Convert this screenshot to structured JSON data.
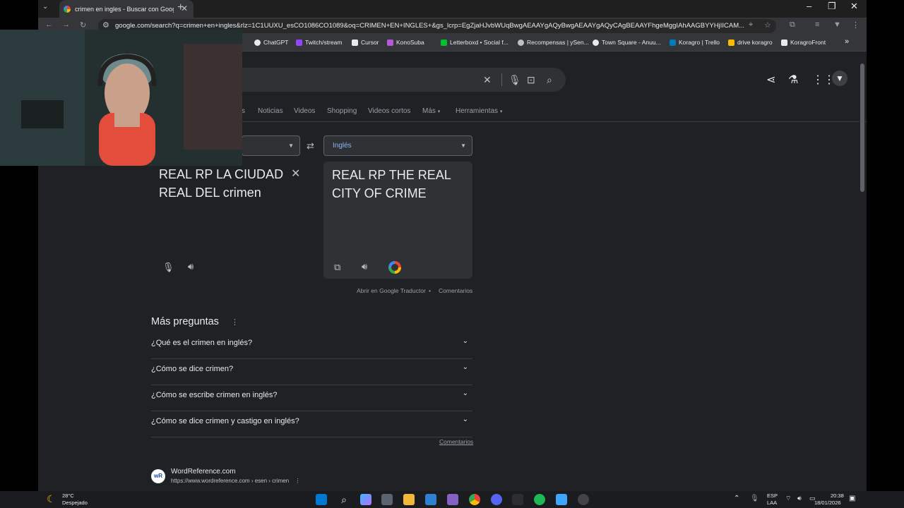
{
  "tab": {
    "title": "crimen en ingles - Buscar con Google"
  },
  "address_bar": {
    "url": "google.com/search?q=crimen+en+ingles&rlz=1C1UUXU_esCO1086CO1089&oq=CRIMEN+EN+INGLES+&gs_lcrp=EgZjaHJvbWUqBwgAEAAYgAQyBwgAEAAYgAQyCAgBEAAYFhgeMggIAhAAGBYYHjIICAM..."
  },
  "bookmarks": [
    {
      "label": "ChatGPT"
    },
    {
      "label": "Twitch/stream"
    },
    {
      "label": "Cursor"
    },
    {
      "label": "KonoSuba"
    },
    {
      "label": "Letterboxd • Social f..."
    },
    {
      "label": "Recompensas | ySen..."
    },
    {
      "label": "Town Square - Anuu..."
    },
    {
      "label": "Koragro | Trello"
    },
    {
      "label": "drive koragro"
    },
    {
      "label": "KoragroFront"
    }
  ],
  "nav_tabs": [
    {
      "label": "Noticias"
    },
    {
      "label": "Videos"
    },
    {
      "label": "Shopping"
    },
    {
      "label": "Videos cortos"
    },
    {
      "label": "Más"
    },
    {
      "label": "Herramientas"
    }
  ],
  "translator": {
    "target_language": "Inglés",
    "source_text": "REAL RP LA CIUDAD REAL DEL crimen",
    "translated_text": "REAL RP THE REAL CITY OF CRIME",
    "open_in_translate": "Abrir en Google Traductor",
    "feedback": "Comentarios"
  },
  "more_questions": {
    "title": "Más preguntas",
    "questions": [
      {
        "text": "¿Qué es el crimen en inglés?"
      },
      {
        "text": "¿Cómo se dice crimen?"
      },
      {
        "text": "¿Cómo se escribe crimen en inglés?"
      },
      {
        "text": "¿Cómo se dice crimen y castigo en inglés?"
      }
    ],
    "feedback": "Comentarios"
  },
  "result": {
    "site_name": "WordReference.com",
    "url": "https://www.wordreference.com › esen › crimen",
    "logo_text": "wR"
  },
  "taskbar": {
    "weather_temp": "28°C",
    "weather_desc": "Despejado",
    "lang_line1": "ESP",
    "lang_line2": "LAA",
    "time": "20:38",
    "date": "18/01/2026"
  }
}
